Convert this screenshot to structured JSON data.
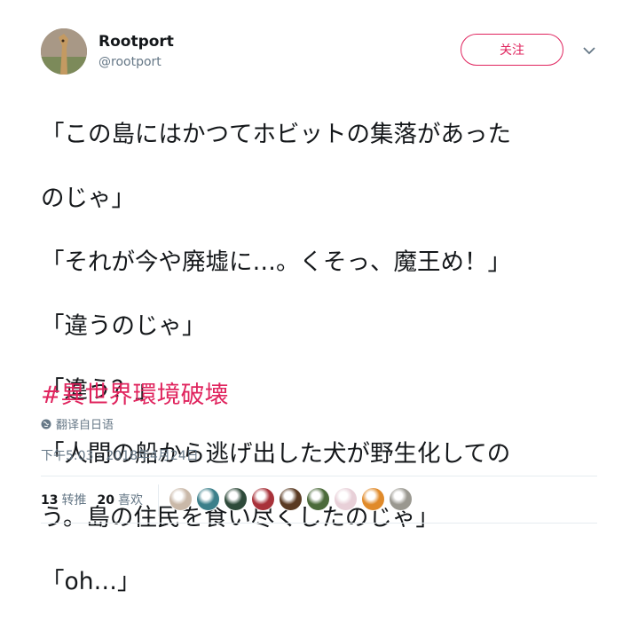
{
  "user": {
    "display_name": "Rootport",
    "handle": "@rootport",
    "follow_label": "关注"
  },
  "tweet": {
    "lines": [
      "「この島にはかつてホビットの集落があった",
      "のじゃ」",
      "「それが今や廃墟に…。くそっ、魔王め！」",
      "「違うのじゃ」",
      "「違う？」",
      "「人間の船から逃げ出した犬が野生化しての",
      "う。島の住民を食い尽くしたのじゃ」",
      "「oh…」"
    ],
    "hashtag": "#異世界環境破壊",
    "translate_label": "翻译自日语",
    "timestamp": "下午5:03 - 2018年4月24日"
  },
  "stats": {
    "retweets_count": "13",
    "retweets_label": "转推",
    "likes_count": "20",
    "likes_label": "喜欢"
  },
  "likers": {
    "avatar_colors": [
      "#c9b8a8",
      "#3b7f8a",
      "#2e4a3a",
      "#a8323a",
      "#5a3a22",
      "#4b6a3a",
      "#e8d0d8",
      "#e08a2a",
      "#9a9890"
    ]
  },
  "colors": {
    "accent": "#e0245e",
    "secondary_text": "#657786",
    "primary_text": "#14171a"
  },
  "icons": {
    "caret": "chevron-down-icon",
    "globe": "globe-icon"
  }
}
